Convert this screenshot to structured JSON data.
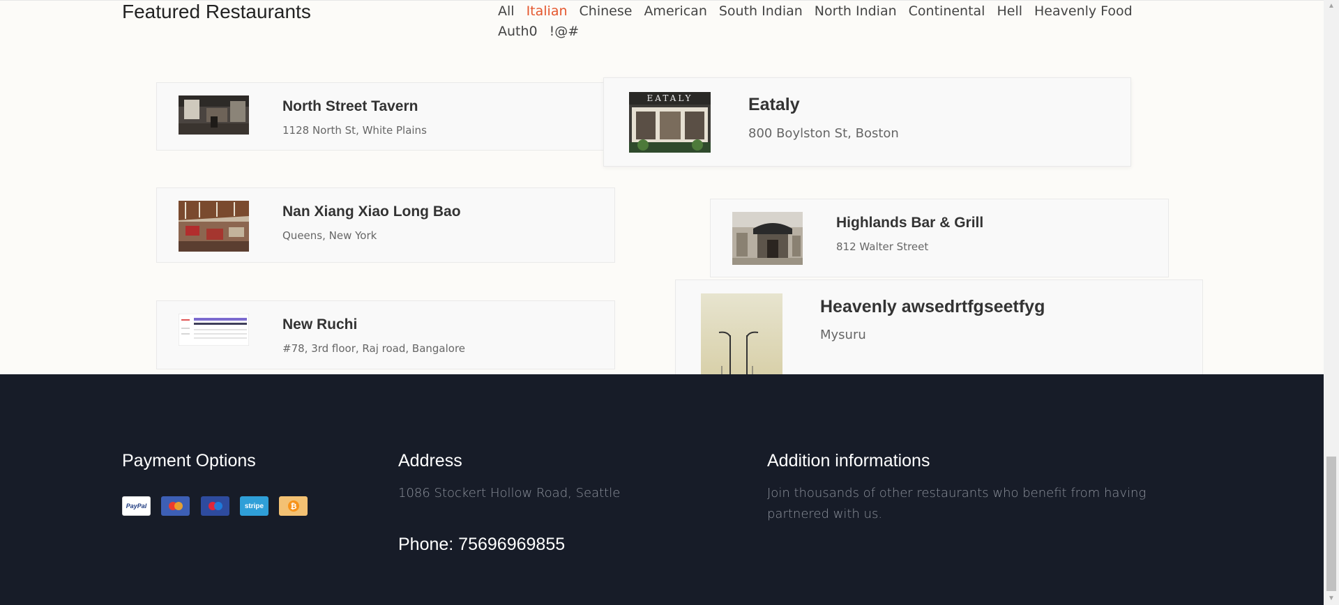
{
  "section": {
    "title": "Featured Restaurants"
  },
  "filters": [
    "All",
    "Italian",
    "Chinese",
    "American",
    "South Indian",
    "North Indian",
    "Continental",
    "Hell",
    "Heavenly Food",
    "Auth0",
    "!@#"
  ],
  "active_filter": "Italian",
  "restaurants": [
    {
      "name": "North Street Tavern",
      "address": "1128 North St, White Plains"
    },
    {
      "name": "Eataly",
      "address": "800 Boylston St, Boston",
      "sign": "EATALY"
    },
    {
      "name": "Nan Xiang Xiao Long Bao",
      "address": "Queens, New York"
    },
    {
      "name": "Highlands Bar & Grill",
      "address": "812 Walter Street"
    },
    {
      "name": "New Ruchi",
      "address": "#78, 3rd floor, Raj road, Bangalore"
    },
    {
      "name": "Heavenly awsedrtfgseetfyg",
      "address": "Mysuru"
    }
  ],
  "footer": {
    "payment": {
      "title": "Payment Options",
      "methods": [
        "PayPal",
        "Mastercard",
        "Maestro",
        "stripe",
        "Bitcoin"
      ],
      "paypal_label": "PayPal",
      "stripe_label": "stripe"
    },
    "address": {
      "title": "Address",
      "text": "1086 Stockert Hollow Road, Seattle",
      "phone": "Phone: 75696969855"
    },
    "info": {
      "title": "Addition informations",
      "text": "Join thousands of other restaurants who benefit from having partnered with us."
    }
  },
  "colors": {
    "accent": "#e4572e",
    "footer_bg": "#171c28"
  }
}
